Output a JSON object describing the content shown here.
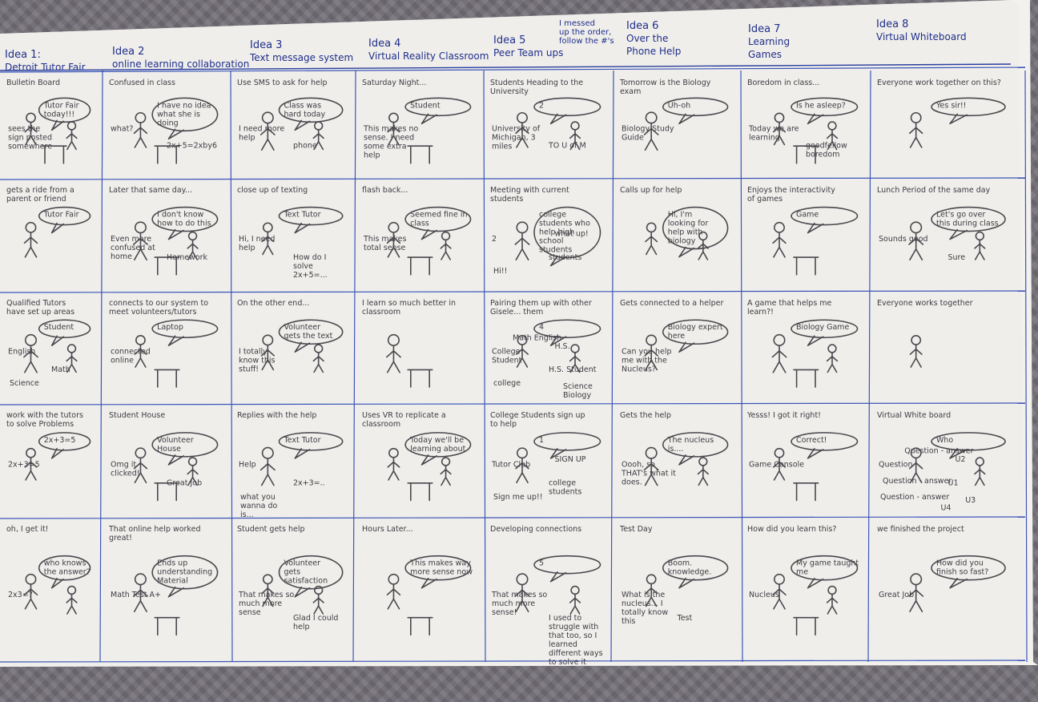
{
  "ideas": [
    {
      "line1": "Idea 1:",
      "line2": "Detroit Tutor Fair"
    },
    {
      "line1": "Idea 2",
      "line2": "online learning collaboration"
    },
    {
      "line1": "Idea 3",
      "line2": "Text message system"
    },
    {
      "line1": "Idea 4",
      "line2": "Virtual Reality Classroom"
    },
    {
      "line1": "Idea 5",
      "line2": "Peer Team ups",
      "note": "I messed up the order, follow the #'s"
    },
    {
      "line1": "Idea 6",
      "line2": "Over the",
      "line3": "Phone Help"
    },
    {
      "line1": "Idea 7",
      "line2": "Learning",
      "line3": "Games"
    },
    {
      "line1": "Idea 8",
      "line2": "Virtual Whiteboard"
    }
  ],
  "panels": {
    "r1": [
      {
        "texts": [
          "Bulletin Board",
          "Tutor Fair today!!!",
          "sees the sign posted somewhere"
        ]
      },
      {
        "texts": [
          "Confused in class",
          "I have no idea what she is doing",
          "what?",
          "2x+5=2xby6"
        ]
      },
      {
        "texts": [
          "Use SMS to ask for help",
          "Class was hard today",
          "I need more help",
          "phone"
        ]
      },
      {
        "texts": [
          "Saturday Night...",
          "Student",
          "This makes no sense. I need some extra help"
        ]
      },
      {
        "texts": [
          "Students Heading to the University",
          "2",
          "University of Michigan, 3 miles",
          "TO U of M"
        ]
      },
      {
        "texts": [
          "Tomorrow is the Biology exam",
          "Uh-oh",
          "Biology Study Guide"
        ]
      },
      {
        "texts": [
          "Boredom in class...",
          "Is he asleep?",
          "Today we are learning",
          "goodfellow boredom"
        ]
      },
      {
        "texts": [
          "Everyone work together on this?",
          "Yes sir!!"
        ]
      }
    ],
    "r2": [
      {
        "texts": [
          "gets a ride from a parent or friend",
          "Tutor Fair"
        ]
      },
      {
        "texts": [
          "Later that same day...",
          "I don't know how to do this",
          "Even more confused at home",
          "Homework"
        ]
      },
      {
        "texts": [
          "close up of texting",
          "Text Tutor",
          "Hi, I need help",
          "How do I solve 2x+5=..."
        ]
      },
      {
        "texts": [
          "flash back...",
          "Seemed fine in class",
          "This makes total sense"
        ]
      },
      {
        "texts": [
          "Meeting with current students",
          "college students who help high school students",
          "2",
          "students",
          "Hi!!",
          "what up!"
        ]
      },
      {
        "texts": [
          "Calls up for help",
          "Hi, I'm looking for help with biology"
        ]
      },
      {
        "texts": [
          "Enjoys the interactivity of games",
          "Game"
        ]
      },
      {
        "texts": [
          "Lunch Period of the same day",
          "Let's go over this during class",
          "Sounds good",
          "Sure"
        ]
      }
    ],
    "r3": [
      {
        "texts": [
          "Qualified Tutors have set up areas",
          "Student",
          "English",
          "Math",
          "Science"
        ]
      },
      {
        "texts": [
          "connects to our system to meet volunteers/tutors",
          "Laptop",
          "connected online"
        ]
      },
      {
        "texts": [
          "On the other end...",
          "Volunteer gets the text",
          "I totally know this stuff!"
        ]
      },
      {
        "texts": [
          "I learn so much better in classroom"
        ]
      },
      {
        "texts": [
          "Pairing them up with other Gisele... them",
          "4",
          "College Student",
          "H.S. Student",
          "college",
          "H.S.",
          "Math English",
          "Science Biology"
        ]
      },
      {
        "texts": [
          "Gets connected to a helper",
          "Biology expert here",
          "Can you help me with the Nucleus?"
        ]
      },
      {
        "texts": [
          "A game that helps me learn?!",
          "Biology Game"
        ]
      },
      {
        "texts": [
          "Everyone works together"
        ]
      }
    ],
    "r4": [
      {
        "texts": [
          "work with the tutors to solve Problems",
          "2x+3=5",
          "2x+3=5"
        ]
      },
      {
        "texts": [
          "Student House",
          "Volunteer House",
          "Omg it clicked!",
          "Great Job"
        ]
      },
      {
        "texts": [
          "Replies with the help",
          "Text Tutor",
          "Help",
          "2x+3=..",
          "what you wanna do is..."
        ]
      },
      {
        "texts": [
          "Uses VR to replicate a classroom",
          "Today we'll be learning about"
        ]
      },
      {
        "texts": [
          "College Students sign up to help",
          "1",
          "Tutor Club",
          "college students",
          "Sign me up!!",
          "SIGN UP"
        ]
      },
      {
        "texts": [
          "Gets the help",
          "The nucleus is....",
          "Oooh, so THAT's what it does."
        ]
      },
      {
        "texts": [
          "Yesss! I got it right!",
          "Correct!",
          "Game Console"
        ]
      },
      {
        "texts": [
          "Virtual White board",
          "Who",
          "Question",
          "U1",
          "Question - answer",
          "U2",
          "Question - answer",
          "U3",
          "Question - answer",
          "U4"
        ]
      }
    ],
    "r5": [
      {
        "texts": [
          "oh, I get it!",
          "who knows the answer?",
          "2x3=?"
        ]
      },
      {
        "texts": [
          "That online help worked great!",
          "Ends up understanding Material",
          "Math Test A+"
        ]
      },
      {
        "texts": [
          "Student gets help",
          "Volunteer gets satisfaction",
          "That makes so much more sense",
          "Glad I could help"
        ]
      },
      {
        "texts": [
          "Hours Later...",
          "This makes way more sense now"
        ]
      },
      {
        "texts": [
          "Developing connections",
          "5",
          "That makes so much more sense!",
          "I used to struggle with that too, so I learned different ways to solve it"
        ]
      },
      {
        "texts": [
          "Test Day",
          "Boom. knowledge.",
          "What is the nucleus... I totally know this",
          "Test"
        ]
      },
      {
        "texts": [
          "How did you learn this?",
          "My game taught me",
          "Nucleus"
        ]
      },
      {
        "texts": [
          "we finished the project",
          "How did you finish so fast?",
          "Great Job"
        ]
      }
    ]
  },
  "colors": {
    "paper": "#f3f1ee",
    "pencil": "#4a484d",
    "ink": "#1f2f8a",
    "grid": "#3a55b8",
    "background": "#757078"
  }
}
